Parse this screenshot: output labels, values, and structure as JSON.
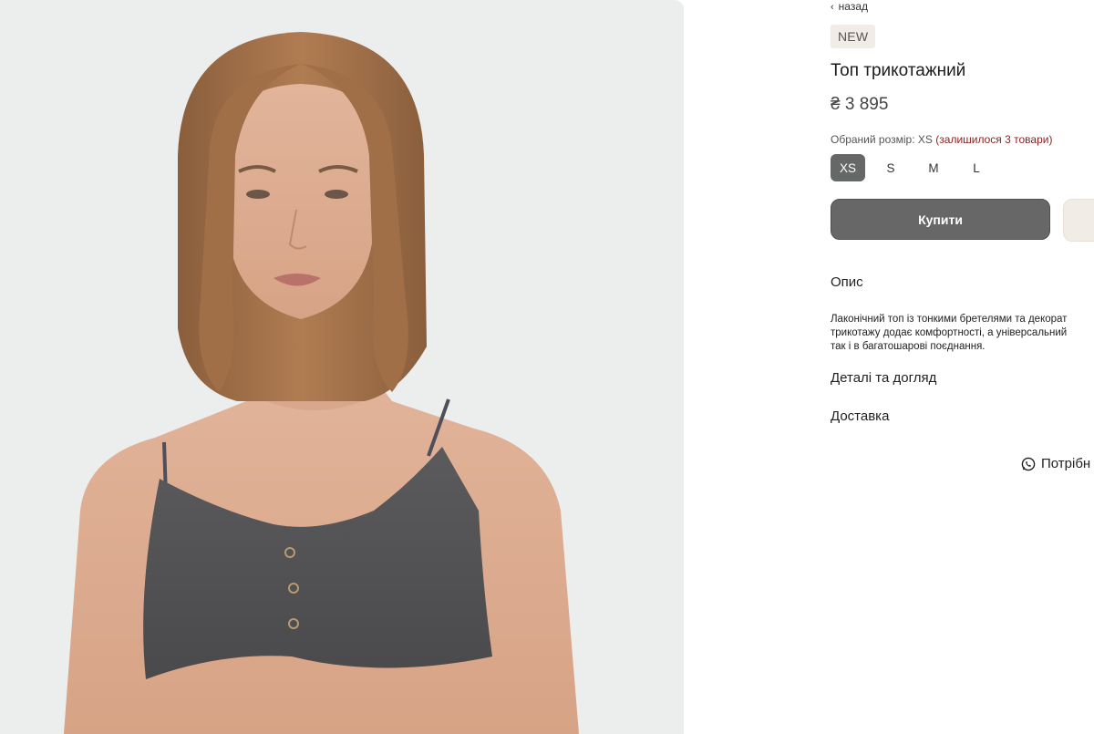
{
  "nav": {
    "back_label": "назад",
    "back_icon": "chevron-left-icon"
  },
  "product": {
    "badge": "NEW",
    "title": "Топ трикотажний",
    "price": "₴ 3 895"
  },
  "size_selector": {
    "prefix": "Обраний розмір: ",
    "selected": "XS",
    "stock_note": "(залишилося 3 товари)",
    "options": [
      "XS",
      "S",
      "M",
      "L"
    ],
    "selected_color": "#666767"
  },
  "actions": {
    "buy_label": "Купити",
    "buy_color": "#676768",
    "wishlist_color": "#f1ece6"
  },
  "accordion": {
    "description_title": "Опис",
    "description_lines": [
      "Лаконічний топ із тонкими бретелями та декорат",
      "трикотажу додає комфортності, а універсальний",
      "так і в багатошарові поєднання."
    ],
    "details_title": "Деталі та догляд",
    "delivery_title": "Доставка"
  },
  "help": {
    "label": "Потрібн",
    "icon": "whatsapp-icon"
  },
  "photo": {
    "background": "#eceded",
    "subject": "model-photo"
  }
}
